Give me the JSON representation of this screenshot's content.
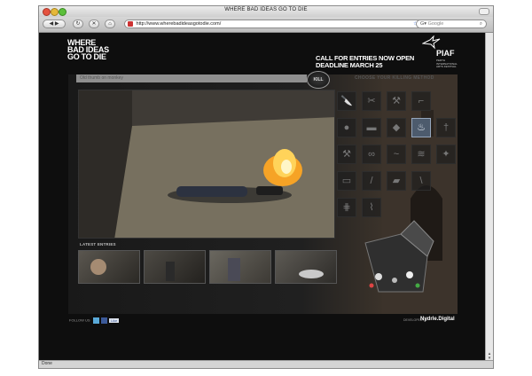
{
  "window": {
    "title": "WHERE BAD IDEAS GO TO DIE",
    "url": "http://www.wherebadideasgotodie.com/",
    "search_placeholder": "Google",
    "status": "Done"
  },
  "site": {
    "logo_lines": [
      "WHERE",
      "BAD IDEAS",
      "GO TO DIE"
    ],
    "call_line1": "CALL FOR ENTRIES NOW OPEN",
    "call_line2": "DEADLINE MARCH 25",
    "brand": "PIAF",
    "brand_sub": "PERTH INTERNATIONAL ARTS FESTIVAL"
  },
  "idea_input": {
    "value": "Old thumb on monkey"
  },
  "kill_button": {
    "label": "KILL"
  },
  "killing_method": {
    "label": "CHOOSE YOUR KILLING METHOD",
    "selected": "fire"
  },
  "tools": [
    "knife",
    "scissors",
    "axe",
    "gun",
    "bomb",
    "car",
    "grenade",
    "fire",
    "sword",
    "hammer",
    "rope",
    "whip",
    "saw",
    "poison",
    "brick",
    "blade",
    "trap",
    "bat",
    "spikes",
    "acid"
  ],
  "latest_entries": {
    "label": "LATEST ENTRIES",
    "count": 4
  },
  "footer": {
    "follow_label": "FOLLOW US",
    "like_label": "Like",
    "developed_by": "DEVELOPED BY",
    "developer": "Nydrle.Digital"
  }
}
